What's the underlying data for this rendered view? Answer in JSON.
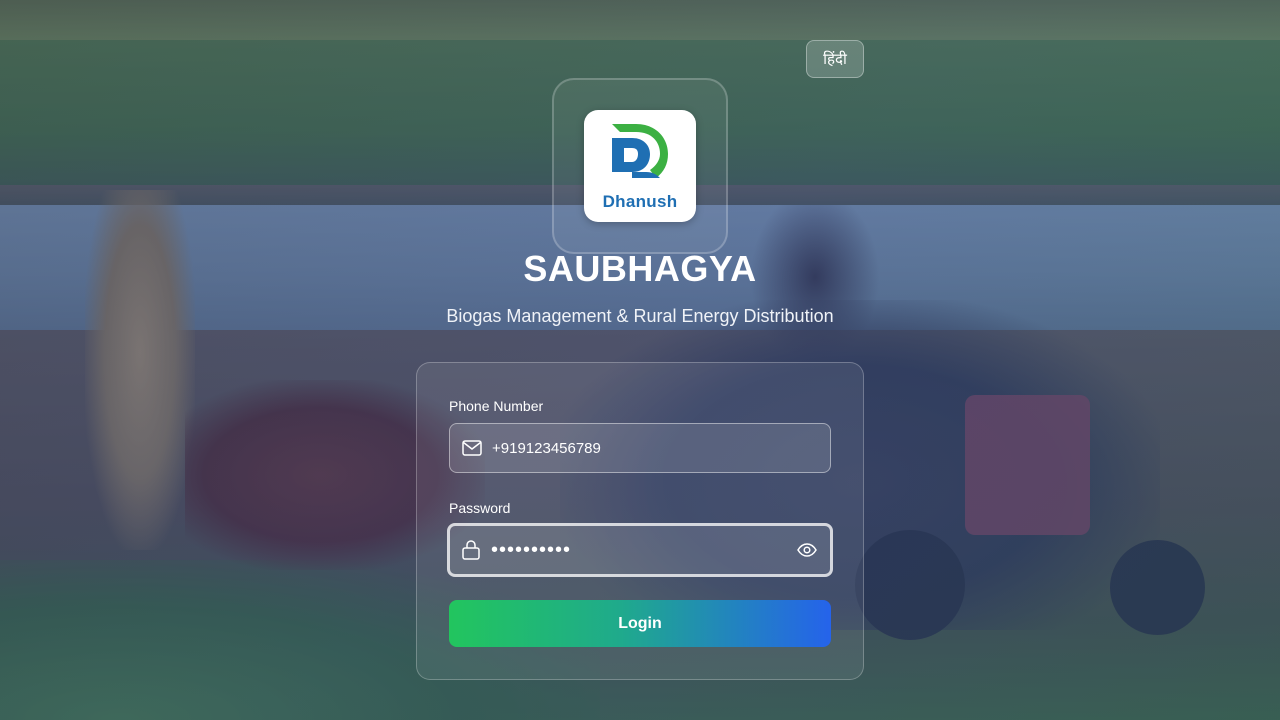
{
  "language_toggle": {
    "label": "हिंदी"
  },
  "logo": {
    "brand_text": "Dhanush",
    "green": "#3cb043",
    "blue": "#1f6fb3"
  },
  "app": {
    "title": "SAUBHAGYA",
    "subtitle": "Biogas Management & Rural Energy Distribution"
  },
  "form": {
    "phone": {
      "label": "Phone Number",
      "value": "+919123456789",
      "icon": "mail-icon"
    },
    "password": {
      "label": "Password",
      "value": "••••••••••",
      "icon": "lock-icon",
      "toggle_icon": "eye-icon"
    },
    "login_button": "Login"
  },
  "colors": {
    "button_gradient_start": "#22c55e",
    "button_gradient_end": "#2563eb"
  }
}
